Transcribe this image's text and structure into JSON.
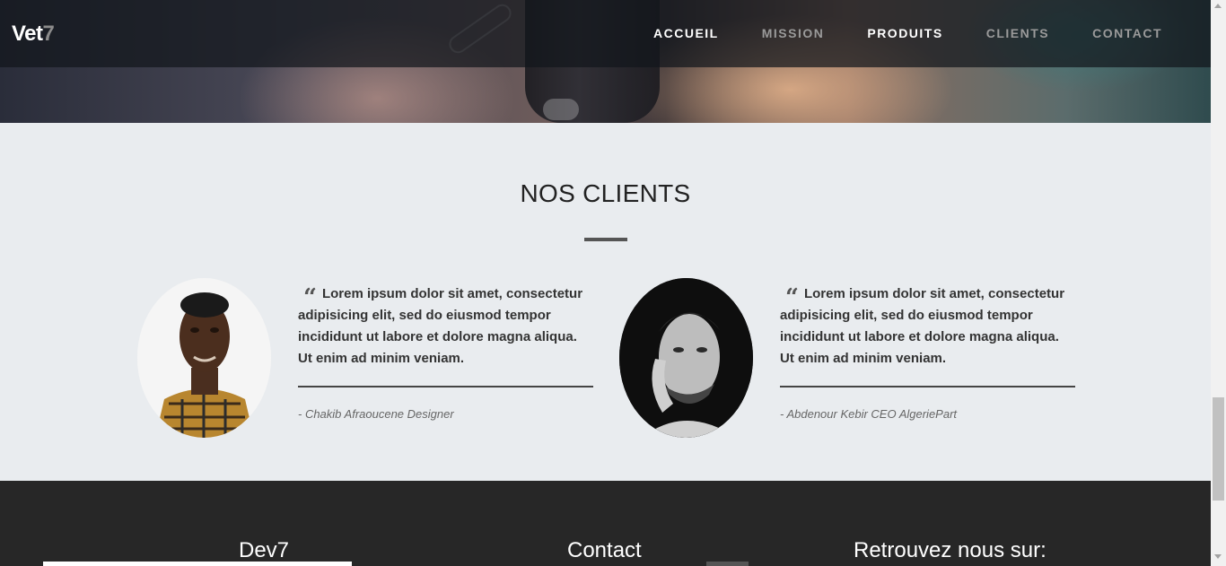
{
  "brand": {
    "name": "Vet",
    "accent": "7"
  },
  "nav": [
    {
      "label": "ACCUEIL",
      "active": true
    },
    {
      "label": "MISSION",
      "active": false
    },
    {
      "label": "PRODUITS",
      "active": true
    },
    {
      "label": "CLIENTS",
      "active": false
    },
    {
      "label": "CONTACT",
      "active": false
    }
  ],
  "clients_section": {
    "title": "NOS CLIENTS",
    "testimonials": [
      {
        "quote": "Lorem ipsum dolor sit amet, consectetur adipisicing elit, sed do eiusmod tempor incididunt ut labore et dolore magna aliqua. Ut enim ad minim veniam.",
        "author": "- Chakib Afraoucene Designer"
      },
      {
        "quote": "Lorem ipsum dolor sit amet, consectetur adipisicing elit, sed do eiusmod tempor incididunt ut labore et dolore magna aliqua. Ut enim ad minim veniam.",
        "author": "- Abdenour Kebir CEO AlgeriePart"
      }
    ]
  },
  "footer": {
    "col1_title": "Dev7",
    "col2_title": "Contact",
    "col3_title": "Retrouvez nous sur:"
  },
  "icons": {
    "quote": "quote-open-icon"
  },
  "colors": {
    "navbar": "#12161c",
    "section_bg": "#e9ecef",
    "footer_bg": "#272727",
    "nav_active": "#ffffff",
    "nav_inactive": "#9a9a9a"
  }
}
